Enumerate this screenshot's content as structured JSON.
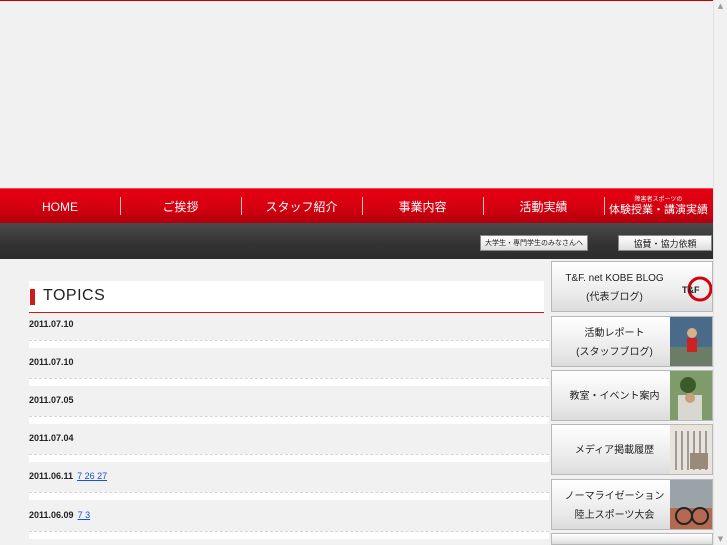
{
  "nav": {
    "items": [
      "HOME",
      "ご挨拶",
      "スタッフ紹介",
      "事業内容",
      "活動実績"
    ],
    "last_small": "障害者スポーツの",
    "last_big": "体験授業・講演実績"
  },
  "band": {
    "students_label": "大学生・専門学生のみなさんへ",
    "support_label": "協賛・協力依頼"
  },
  "topics": {
    "title": "TOPICS",
    "items": [
      {
        "date": "2011.07.10",
        "link": ""
      },
      {
        "date": "2011.07.10",
        "link": ""
      },
      {
        "date": "2011.07.05",
        "link": ""
      },
      {
        "date": "2011.07.04",
        "link": ""
      },
      {
        "date": "2011.06.11",
        "link": "7 26 27"
      },
      {
        "date": "2011.06.09",
        "link": "7 3"
      }
    ]
  },
  "sidebar": {
    "blog_line1": "T&F. net KOBE BLOG",
    "blog_line2": "(代表ブログ)",
    "blog_logo": "T&F",
    "report_line1": "活動レポート",
    "report_line2": "(スタッフブログ)",
    "classroom": "教室・イベント案内",
    "media": "メディア掲載履歴",
    "normalization_line1": "ノーマライゼーション",
    "normalization_line2": "陸上スポーツ大会"
  },
  "colors": {
    "brand_red": "#d40010",
    "link_blue": "#1a4fd6",
    "band_dark": "#333333"
  }
}
